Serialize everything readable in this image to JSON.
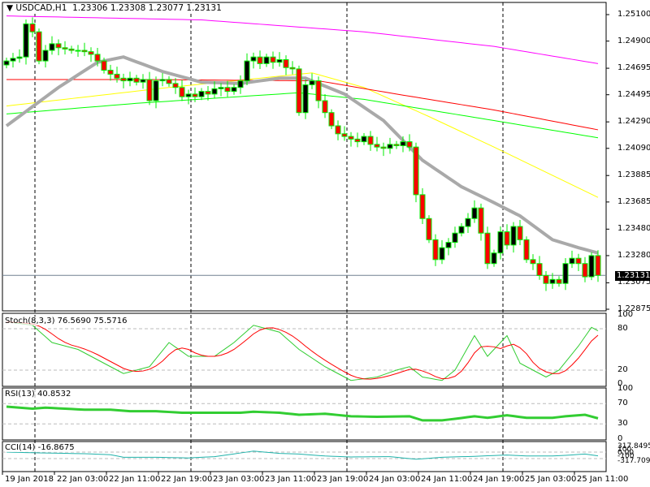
{
  "header": {
    "symbol": "USDCAD,H1",
    "open": "1.23306",
    "high": "1.23308",
    "low": "1.23077",
    "close": "1.23131",
    "menu_icon": "triangle-down-icon"
  },
  "price_axis": [
    "1.25100",
    "1.24900",
    "1.24695",
    "1.24495",
    "1.24290",
    "1.24090",
    "1.23885",
    "1.23685",
    "1.23480",
    "1.23280",
    "1.23075",
    "1.22875"
  ],
  "current_price": "1.23131",
  "time_axis": [
    "19 Jan 2018",
    "22 Jan 03:00",
    "22 Jan 11:00",
    "22 Jan 19:00",
    "23 Jan 03:00",
    "23 Jan 11:00",
    "23 Jan 19:00",
    "24 Jan 03:00",
    "24 Jan 11:00",
    "24 Jan 19:00",
    "25 Jan 03:00",
    "25 Jan 11:00"
  ],
  "colors": {
    "bull_outline": "#00ee00",
    "bear": "#ff0000",
    "ma_gray": "#a9a9a9",
    "ma_red": "#ff0000",
    "ma_green": "#00ff00",
    "ma_yellow": "#ffff00",
    "ma_magenta": "#ff00ff",
    "stoch_k": "#32cd32",
    "stoch_d": "#ff0000",
    "rsi": "#32cd32",
    "cci": "#20b2aa"
  },
  "closes": [
    1.2475,
    1.2477,
    1.2478,
    1.2503,
    1.2497,
    1.2475,
    1.2483,
    1.2488,
    1.2485,
    1.2484,
    1.2483,
    1.2483,
    1.2482,
    1.248,
    1.2475,
    1.2468,
    1.2465,
    1.2462,
    1.246,
    1.2462,
    1.2459,
    1.2461,
    1.2445,
    1.246,
    1.2461,
    1.2458,
    1.2455,
    1.2448,
    1.245,
    1.2448,
    1.2452,
    1.245,
    1.2454,
    1.2455,
    1.2452,
    1.2455,
    1.246,
    1.2475,
    1.2478,
    1.2473,
    1.2478,
    1.2474,
    1.2476,
    1.247,
    1.2469,
    1.2436,
    1.2457,
    1.246,
    1.2445,
    1.2436,
    1.2426,
    1.242,
    1.2418,
    1.2416,
    1.2414,
    1.2418,
    1.2412,
    1.241,
    1.2409,
    1.2412,
    1.2411,
    1.2414,
    1.241,
    1.2374,
    1.2356,
    1.234,
    1.2325,
    1.2334,
    1.2338,
    1.2345,
    1.235,
    1.2356,
    1.2364,
    1.2345,
    1.2322,
    1.233,
    1.2346,
    1.2336,
    1.235,
    1.234,
    1.2325,
    1.2322,
    1.2313,
    1.2307,
    1.231,
    1.2307,
    1.2322,
    1.2326,
    1.2322,
    1.2312,
    1.2328,
    1.23131
  ],
  "moving_averages": [
    {
      "name": "ma-gray",
      "color": "#a9a9a9",
      "width": 4,
      "points": [
        [
          0,
          1.2426
        ],
        [
          8,
          1.2455
        ],
        [
          14,
          1.2474
        ],
        [
          18,
          1.2478
        ],
        [
          24,
          1.2467
        ],
        [
          30,
          1.2459
        ],
        [
          36,
          1.2458
        ],
        [
          42,
          1.2462
        ],
        [
          46,
          1.2462
        ],
        [
          52,
          1.245
        ],
        [
          58,
          1.243
        ],
        [
          64,
          1.24
        ],
        [
          70,
          1.238
        ],
        [
          75,
          1.2368
        ],
        [
          79,
          1.2358
        ],
        [
          84,
          1.234
        ],
        [
          88,
          1.2334
        ],
        [
          91,
          1.233
        ]
      ]
    },
    {
      "name": "ma-red",
      "color": "#ff0000",
      "width": 1,
      "points": [
        [
          0,
          1.2461
        ],
        [
          20,
          1.2461
        ],
        [
          48,
          1.246
        ],
        [
          60,
          1.245
        ],
        [
          75,
          1.2438
        ],
        [
          91,
          1.2423
        ]
      ]
    },
    {
      "name": "ma-green",
      "color": "#00ff00",
      "width": 1,
      "points": [
        [
          0,
          1.2435
        ],
        [
          20,
          1.2443
        ],
        [
          45,
          1.2451
        ],
        [
          55,
          1.2446
        ],
        [
          75,
          1.243
        ],
        [
          91,
          1.2417
        ]
      ]
    },
    {
      "name": "ma-yellow",
      "color": "#ffff00",
      "width": 1,
      "points": [
        [
          0,
          1.2441
        ],
        [
          25,
          1.2455
        ],
        [
          47,
          1.2466
        ],
        [
          55,
          1.2455
        ],
        [
          65,
          1.2433
        ],
        [
          75,
          1.241
        ],
        [
          91,
          1.2372
        ]
      ]
    },
    {
      "name": "ma-magenta",
      "color": "#ff00ff",
      "width": 1,
      "points": [
        [
          0,
          1.2509
        ],
        [
          30,
          1.2506
        ],
        [
          55,
          1.2497
        ],
        [
          75,
          1.2486
        ],
        [
          91,
          1.2473
        ]
      ]
    }
  ],
  "stoch": {
    "label": "Stoch(8,3,3) 76.5690 75.5716",
    "axis": [
      "100",
      "80",
      "20",
      "0"
    ],
    "k": [
      [
        0,
        90
      ],
      [
        4,
        85
      ],
      [
        7,
        60
      ],
      [
        11,
        50
      ],
      [
        14,
        35
      ],
      [
        18,
        15
      ],
      [
        22,
        25
      ],
      [
        25,
        60
      ],
      [
        28,
        40
      ],
      [
        32,
        40
      ],
      [
        35,
        60
      ],
      [
        38,
        85
      ],
      [
        42,
        75
      ],
      [
        45,
        50
      ],
      [
        49,
        25
      ],
      [
        53,
        5
      ],
      [
        57,
        10
      ],
      [
        60,
        20
      ],
      [
        62,
        25
      ],
      [
        64,
        10
      ],
      [
        67,
        5
      ],
      [
        69,
        20
      ],
      [
        72,
        70
      ],
      [
        74,
        40
      ],
      [
        77,
        70
      ],
      [
        79,
        30
      ],
      [
        83,
        10
      ],
      [
        85,
        20
      ],
      [
        88,
        55
      ],
      [
        90,
        82
      ],
      [
        91,
        77
      ]
    ]
  },
  "rsi": {
    "label": "RSI(13) 40.8532",
    "axis": [
      "100",
      "70",
      "30",
      "0"
    ],
    "values": [
      [
        0,
        64
      ],
      [
        4,
        60
      ],
      [
        6,
        62
      ],
      [
        12,
        58
      ],
      [
        16,
        58
      ],
      [
        19,
        55
      ],
      [
        23,
        55
      ],
      [
        27,
        52
      ],
      [
        31,
        52
      ],
      [
        36,
        52
      ],
      [
        38,
        54
      ],
      [
        42,
        52
      ],
      [
        45,
        48
      ],
      [
        49,
        50
      ],
      [
        53,
        45
      ],
      [
        57,
        44
      ],
      [
        62,
        45
      ],
      [
        64,
        37
      ],
      [
        67,
        37
      ],
      [
        69,
        40
      ],
      [
        72,
        45
      ],
      [
        74,
        42
      ],
      [
        77,
        47
      ],
      [
        80,
        42
      ],
      [
        84,
        42
      ],
      [
        86,
        45
      ],
      [
        89,
        48
      ],
      [
        91,
        41
      ]
    ]
  },
  "cci": {
    "label": "CCI(14) -16.8675",
    "axis": [
      "317.8495",
      "100",
      "0.00",
      "-100",
      "-317.7091"
    ],
    "values": [
      [
        0,
        100
      ],
      [
        4,
        80
      ],
      [
        12,
        50
      ],
      [
        16,
        20
      ],
      [
        18,
        -60
      ],
      [
        23,
        -60
      ],
      [
        28,
        -80
      ],
      [
        32,
        -40
      ],
      [
        38,
        130
      ],
      [
        42,
        60
      ],
      [
        45,
        40
      ],
      [
        49,
        -20
      ],
      [
        53,
        -50
      ],
      [
        59,
        -40
      ],
      [
        63,
        -120
      ],
      [
        67,
        -60
      ],
      [
        72,
        -30
      ],
      [
        77,
        10
      ],
      [
        80,
        -20
      ],
      [
        84,
        -20
      ],
      [
        86,
        0
      ],
      [
        89,
        40
      ],
      [
        91,
        -17
      ]
    ]
  }
}
